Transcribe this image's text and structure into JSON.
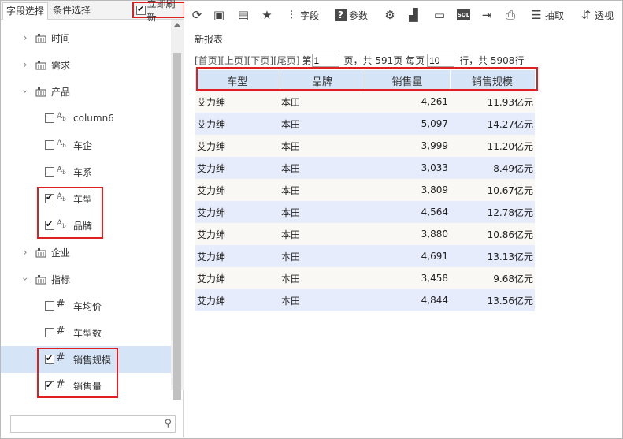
{
  "tabs": {
    "field_select": "字段选择",
    "condition_select": "条件选择"
  },
  "refresh": {
    "label": "立即刷新",
    "checked": true
  },
  "tree": {
    "groups": [
      {
        "label": "时间",
        "expanded": false
      },
      {
        "label": "需求",
        "expanded": false
      },
      {
        "label": "产品",
        "expanded": true
      },
      {
        "label": "企业",
        "expanded": false
      },
      {
        "label": "指标",
        "expanded": true
      }
    ],
    "product_fields": [
      {
        "label": "column6",
        "checked": false,
        "type": "Ab"
      },
      {
        "label": "车企",
        "checked": false,
        "type": "Ab"
      },
      {
        "label": "车系",
        "checked": false,
        "type": "Ab"
      },
      {
        "label": "车型",
        "checked": true,
        "type": "Ab"
      },
      {
        "label": "品牌",
        "checked": true,
        "type": "Ab"
      }
    ],
    "metric_fields": [
      {
        "label": "车均价",
        "checked": false,
        "type": "#"
      },
      {
        "label": "车型数",
        "checked": false,
        "type": "#"
      },
      {
        "label": "销售规模",
        "checked": true,
        "type": "#"
      },
      {
        "label": "销售量",
        "checked": true,
        "type": "#"
      }
    ]
  },
  "search": {
    "placeholder": ""
  },
  "toolbar": {
    "field": "字段",
    "param": "参数",
    "extract": "抽取",
    "pivot": "透视",
    "sql": "SQL"
  },
  "report": {
    "title": "新报表",
    "pager": {
      "first": "[首页]",
      "prev": "[上页]",
      "next": "[下页]",
      "last": "[尾页]",
      "page_prefix": "第",
      "page_value": "1",
      "page_suffix": "页，共 591页 每页",
      "per_page": "10",
      "rows_suffix": "行，共 5908行"
    },
    "columns": [
      "车型",
      "品牌",
      "销售量",
      "销售规模"
    ],
    "rows": [
      [
        "艾力绅",
        "本田",
        "4,261",
        "11.93亿元"
      ],
      [
        "艾力绅",
        "本田",
        "5,097",
        "14.27亿元"
      ],
      [
        "艾力绅",
        "本田",
        "3,999",
        "11.20亿元"
      ],
      [
        "艾力绅",
        "本田",
        "3,033",
        "8.49亿元"
      ],
      [
        "艾力绅",
        "本田",
        "3,809",
        "10.67亿元"
      ],
      [
        "艾力绅",
        "本田",
        "4,564",
        "12.78亿元"
      ],
      [
        "艾力绅",
        "本田",
        "3,880",
        "10.86亿元"
      ],
      [
        "艾力绅",
        "本田",
        "4,691",
        "13.13亿元"
      ],
      [
        "艾力绅",
        "本田",
        "3,458",
        "9.68亿元"
      ],
      [
        "艾力绅",
        "本田",
        "4,844",
        "13.56亿元"
      ]
    ]
  }
}
